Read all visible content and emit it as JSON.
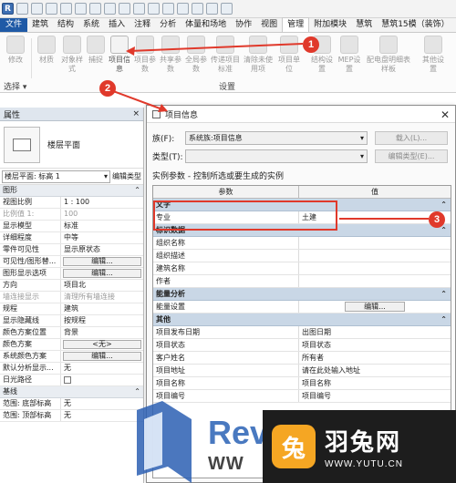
{
  "tabs": [
    "文件",
    "建筑",
    "结构",
    "系统",
    "插入",
    "注释",
    "分析",
    "体量和场地",
    "协作",
    "视图",
    "管理",
    "附加模块",
    "慧筑",
    "慧筑15模（装饰）"
  ],
  "active_tab": "管理",
  "ribbon": {
    "buttons": [
      {
        "label": "修改"
      },
      {
        "label": "材质"
      },
      {
        "label": "对象样式"
      },
      {
        "label": "捕捉"
      },
      {
        "label": "项目信息"
      },
      {
        "label": "项目参数"
      },
      {
        "label": "共享参数"
      },
      {
        "label": "全局参数"
      },
      {
        "label": "传递项目标准"
      },
      {
        "label": "清除未使用项"
      },
      {
        "label": "项目单位"
      },
      {
        "label": "结构设置"
      },
      {
        "label": "MEP设置"
      },
      {
        "label": "配电盘明细表样板"
      },
      {
        "label": "其他设置"
      }
    ],
    "select_label": "选择 ▾",
    "group_label": "设置"
  },
  "callouts": [
    "1",
    "2",
    "3"
  ],
  "properties": {
    "title": "属性",
    "close": "×",
    "type_name": "楼层平面",
    "selector": "楼层平面: 标高 1",
    "edit_type": "编辑类型",
    "rows": [
      {
        "kind": "group",
        "label": "图形"
      },
      {
        "k": "视图比例",
        "v": "1 : 100"
      },
      {
        "k": "比例值 1:",
        "v": "100",
        "dim": true
      },
      {
        "k": "显示模型",
        "v": "标准"
      },
      {
        "k": "详细程度",
        "v": "中等"
      },
      {
        "k": "零件可见性",
        "v": "显示原状态"
      },
      {
        "k": "可见性/图形替...",
        "btn": "编辑..."
      },
      {
        "k": "图形显示选项",
        "btn": "编辑..."
      },
      {
        "k": "方向",
        "v": "项目北"
      },
      {
        "k": "墙连接显示",
        "v": "清理所有墙连接",
        "dim": true
      },
      {
        "k": "规程",
        "v": "建筑"
      },
      {
        "k": "显示隐藏线",
        "v": "按规程"
      },
      {
        "k": "颜色方案位置",
        "v": "背景"
      },
      {
        "k": "颜色方案",
        "btn": "<无>"
      },
      {
        "k": "系统颜色方案",
        "btn": "编辑..."
      },
      {
        "k": "默认分析显示...",
        "v": "无"
      },
      {
        "k": "日光路径",
        "check": true
      },
      {
        "kind": "group",
        "label": "基线"
      },
      {
        "k": "范围: 底部标高",
        "v": "无"
      },
      {
        "k": "范围: 顶部标高",
        "v": "无"
      }
    ]
  },
  "dialog": {
    "title": "项目信息",
    "close": "✕",
    "family_label": "族(F):",
    "family_value": "系统族:项目信息",
    "type_label": "类型(T):",
    "type_value": "",
    "load_button": "载入(L)...",
    "edit_type_button": "编辑类型(E)...",
    "instance_hint": "实例参数 - 控制所选或要生成的实例",
    "col_param": "参数",
    "col_value": "值",
    "rows": [
      {
        "kind": "group",
        "label": "文字"
      },
      {
        "k": "专业",
        "v": "土建"
      },
      {
        "kind": "group",
        "label": "标识数据"
      },
      {
        "k": "组织名称",
        "v": ""
      },
      {
        "k": "组织描述",
        "v": ""
      },
      {
        "k": "建筑名称",
        "v": ""
      },
      {
        "k": "作者",
        "v": ""
      },
      {
        "kind": "group",
        "label": "能量分析"
      },
      {
        "k": "能量设置",
        "btn": "编辑..."
      },
      {
        "kind": "group",
        "label": "其他"
      },
      {
        "k": "项目发布日期",
        "v": "出图日期"
      },
      {
        "k": "项目状态",
        "v": "项目状态"
      },
      {
        "k": "客户姓名",
        "v": "所有者"
      },
      {
        "k": "项目地址",
        "v": "请在此处输入地址"
      },
      {
        "k": "项目名称",
        "v": "项目名称"
      },
      {
        "k": "项目编号",
        "v": "项目编号"
      }
    ]
  },
  "watermarks": {
    "revit_text": "Rev",
    "revit_sub": "WW",
    "yutu_cn": "羽兔网",
    "yutu_url": "WWW.YUTU.CN"
  },
  "colors": {
    "accent": "#1f5aa6",
    "callout": "#e0392b",
    "group_header": "#c9d7e6"
  }
}
